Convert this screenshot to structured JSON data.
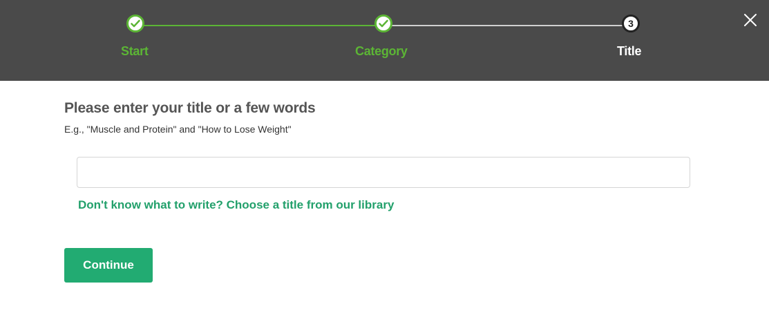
{
  "stepper": {
    "steps": [
      {
        "label": "Start",
        "state": "complete",
        "icon": "check-icon"
      },
      {
        "label": "Category",
        "state": "complete",
        "icon": "check-icon"
      },
      {
        "label": "Title",
        "state": "current",
        "number": "3"
      }
    ],
    "colors": {
      "complete": "#5cb535",
      "current": "#ffffff",
      "header_bg": "#4a4a4a"
    }
  },
  "header": {
    "close_icon": "close-icon"
  },
  "main": {
    "heading": "Please enter your title or a few words",
    "subtext": "E.g., \"Muscle and Protein\" and \"How to Lose Weight\"",
    "title_input": {
      "value": "",
      "placeholder": ""
    },
    "library_link": "Don't know what to write? Choose a title from our library",
    "continue_label": "Continue"
  },
  "colors": {
    "accent": "#22ab72",
    "link": "#22a06b"
  }
}
